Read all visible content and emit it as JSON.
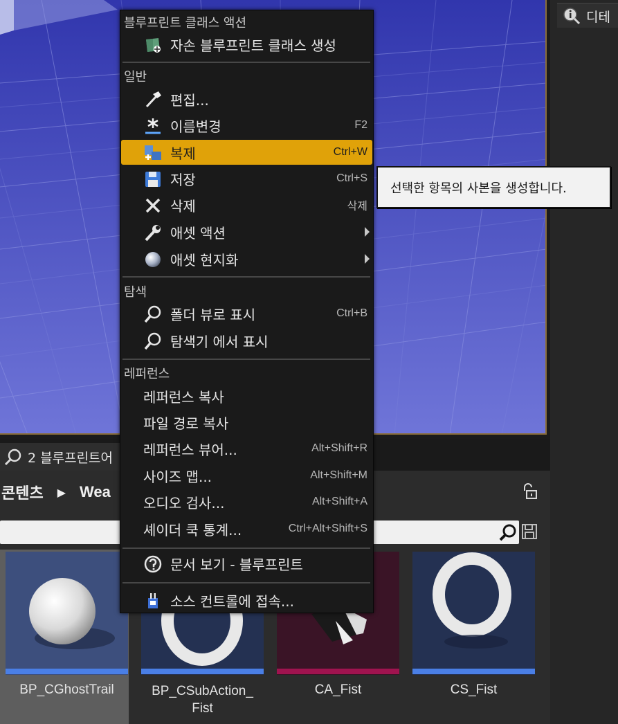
{
  "menu": {
    "sections": {
      "blueprint_class": "블루프린트 클래스 액션",
      "general": "일반",
      "explore": "탐색",
      "references": "레퍼런스"
    },
    "items": {
      "create_child": {
        "label": "자손 블루프린트 클래스 생성",
        "icon": "blueprint-class-icon"
      },
      "edit": {
        "label": "편집...",
        "icon": "hammer-icon"
      },
      "rename": {
        "label": "이름변경",
        "shortcut": "F2",
        "icon": "rename-star-icon"
      },
      "duplicate": {
        "label": "복제",
        "shortcut": "Ctrl+W",
        "icon": "duplicate-icon"
      },
      "save": {
        "label": "저장",
        "shortcut": "Ctrl+S",
        "icon": "floppy-disk-icon"
      },
      "delete": {
        "label": "삭제",
        "shortcut": "삭제",
        "icon": "x-icon"
      },
      "asset_actions": {
        "label": "애셋 액션",
        "icon": "wrench-icon"
      },
      "asset_localization": {
        "label": "애셋 현지화",
        "icon": "globe-icon"
      },
      "show_folder_view": {
        "label": "폴더 뷰로 표시",
        "shortcut": "Ctrl+B",
        "icon": "magnifier-icon"
      },
      "show_in_explorer": {
        "label": "탐색기 에서 표시",
        "icon": "magnifier-icon"
      },
      "copy_reference": {
        "label": "레퍼런스 복사"
      },
      "copy_file_path": {
        "label": "파일 경로 복사"
      },
      "reference_viewer": {
        "label": "레퍼런스 뷰어...",
        "shortcut": "Alt+Shift+R"
      },
      "size_map": {
        "label": "사이즈 맵...",
        "shortcut": "Alt+Shift+M"
      },
      "audit": {
        "label": "오디오 검사...",
        "shortcut": "Alt+Shift+A"
      },
      "shader_cook_stats": {
        "label": "셰이더 쿡 통계...",
        "shortcut": "Ctrl+Alt+Shift+S"
      },
      "view_docs": {
        "label": "문서 보기 - 블루프린트",
        "icon": "help-circle-icon"
      },
      "source_control": {
        "label": "소스 컨트롤에 접속...",
        "icon": "source-control-icon"
      }
    }
  },
  "tooltip": {
    "text": "선택한 항목의 사본을 생성합니다."
  },
  "right_panel": {
    "tab_label": "디테"
  },
  "content_browser": {
    "tab_label": "2 블루프린트어",
    "breadcrumb": [
      "콘텐츠",
      "Wea"
    ],
    "assets": [
      {
        "name": "BP_CGhostTrail",
        "thumb": "sphere",
        "bar_color": "#4a7fe6",
        "selected": true
      },
      {
        "name": "BP_CSubAction_\nFist",
        "thumb": "ring",
        "bar_color": "#4a7fe6",
        "selected": false
      },
      {
        "name": "CA_Fist",
        "thumb": "anim",
        "bar_color": "#a0134f",
        "selected": false
      },
      {
        "name": "CS_Fist",
        "thumb": "ring",
        "bar_color": "#4a7fe6",
        "selected": false
      }
    ]
  },
  "colors": {
    "highlight": "#e0a209",
    "menu_bg": "#1a1a1a",
    "viewport_floor": "#4b52c9"
  }
}
